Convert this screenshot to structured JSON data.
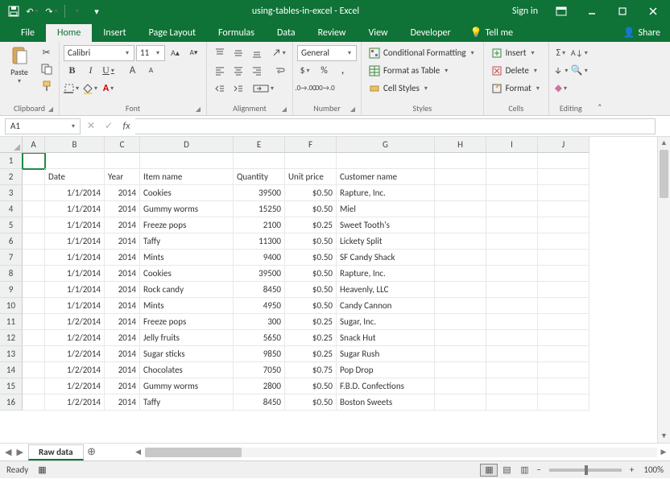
{
  "window": {
    "title": "using-tables-in-excel - Excel",
    "signin": "Sign in"
  },
  "tabs": [
    "File",
    "Home",
    "Insert",
    "Page Layout",
    "Formulas",
    "Data",
    "Review",
    "View",
    "Developer"
  ],
  "tabs_extra": {
    "tellme": "Tell me",
    "share": "Share"
  },
  "ribbon": {
    "clipboard": {
      "paste": "Paste",
      "label": "Clipboard"
    },
    "font": {
      "name": "Calibri",
      "size": "11",
      "label": "Font"
    },
    "alignment": {
      "label": "Alignment"
    },
    "number": {
      "format": "General",
      "label": "Number"
    },
    "styles": {
      "cond": "Conditional Formatting",
      "table": "Format as Table",
      "cellstyles": "Cell Styles",
      "label": "Styles"
    },
    "cells": {
      "insert": "Insert",
      "delete": "Delete",
      "format": "Format",
      "label": "Cells"
    },
    "editing": {
      "label": "Editing"
    }
  },
  "namebox": "A1",
  "columns": [
    "A",
    "B",
    "C",
    "D",
    "E",
    "F",
    "G",
    "H",
    "I",
    "J"
  ],
  "headers": {
    "B": "Date",
    "C": "Year",
    "D": "Item name",
    "E": "Quantity",
    "F": "Unit price",
    "G": "Customer name"
  },
  "rows": [
    {
      "n": 3,
      "B": "1/1/2014",
      "C": "2014",
      "D": "Cookies",
      "E": "39500",
      "F": "$0.50",
      "G": "Rapture, Inc."
    },
    {
      "n": 4,
      "B": "1/1/2014",
      "C": "2014",
      "D": "Gummy worms",
      "E": "15250",
      "F": "$0.50",
      "G": "Miel"
    },
    {
      "n": 5,
      "B": "1/1/2014",
      "C": "2014",
      "D": "Freeze pops",
      "E": "2100",
      "F": "$0.25",
      "G": "Sweet Tooth's"
    },
    {
      "n": 6,
      "B": "1/1/2014",
      "C": "2014",
      "D": "Taffy",
      "E": "11300",
      "F": "$0.50",
      "G": "Lickety Split"
    },
    {
      "n": 7,
      "B": "1/1/2014",
      "C": "2014",
      "D": "Mints",
      "E": "9400",
      "F": "$0.50",
      "G": "SF Candy Shack"
    },
    {
      "n": 8,
      "B": "1/1/2014",
      "C": "2014",
      "D": "Cookies",
      "E": "39500",
      "F": "$0.50",
      "G": "Rapture, Inc."
    },
    {
      "n": 9,
      "B": "1/1/2014",
      "C": "2014",
      "D": "Rock candy",
      "E": "8450",
      "F": "$0.50",
      "G": "Heavenly, LLC"
    },
    {
      "n": 10,
      "B": "1/1/2014",
      "C": "2014",
      "D": "Mints",
      "E": "4950",
      "F": "$0.50",
      "G": "Candy Cannon"
    },
    {
      "n": 11,
      "B": "1/2/2014",
      "C": "2014",
      "D": "Freeze pops",
      "E": "300",
      "F": "$0.25",
      "G": "Sugar, Inc."
    },
    {
      "n": 12,
      "B": "1/2/2014",
      "C": "2014",
      "D": "Jelly fruits",
      "E": "5650",
      "F": "$0.25",
      "G": "Snack Hut"
    },
    {
      "n": 13,
      "B": "1/2/2014",
      "C": "2014",
      "D": "Sugar sticks",
      "E": "9850",
      "F": "$0.25",
      "G": "Sugar Rush"
    },
    {
      "n": 14,
      "B": "1/2/2014",
      "C": "2014",
      "D": "Chocolates",
      "E": "7050",
      "F": "$0.75",
      "G": "Pop Drop"
    },
    {
      "n": 15,
      "B": "1/2/2014",
      "C": "2014",
      "D": "Gummy worms",
      "E": "2800",
      "F": "$0.50",
      "G": "F.B.D. Confections"
    },
    {
      "n": 16,
      "B": "1/2/2014",
      "C": "2014",
      "D": "Taffy",
      "E": "8450",
      "F": "$0.50",
      "G": "Boston Sweets"
    }
  ],
  "sheet": {
    "name": "Raw data"
  },
  "status": {
    "ready": "Ready",
    "zoom": "100%"
  }
}
